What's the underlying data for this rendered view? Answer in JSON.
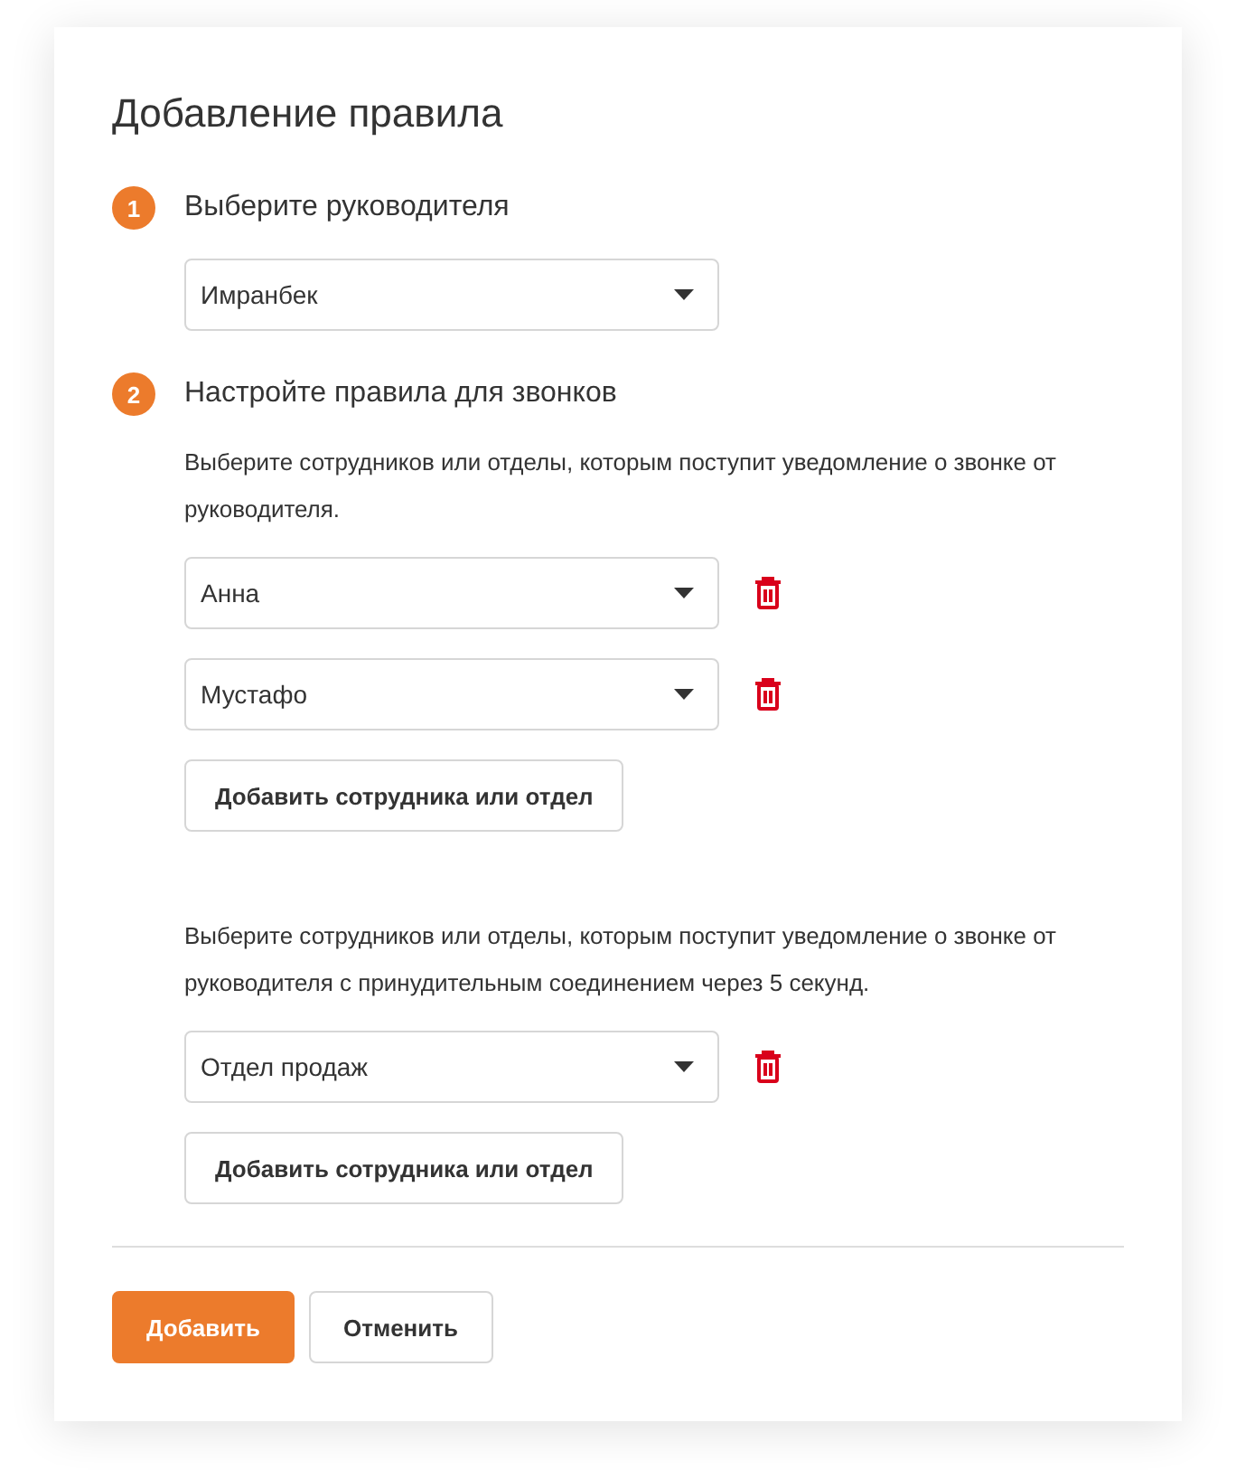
{
  "title": "Добавление правила",
  "steps": [
    {
      "number": "1",
      "label": "Выберите руководителя",
      "selects": [
        {
          "value": "Имранбек",
          "deletable": false
        }
      ]
    },
    {
      "number": "2",
      "label": "Настройте правила для звонков",
      "groups": [
        {
          "description": "Выберите сотрудников или отделы, которым поступит уведомление о звонке от руководителя.",
          "selects": [
            {
              "value": "Анна",
              "deletable": true
            },
            {
              "value": "Мустафо",
              "deletable": true
            }
          ],
          "add_button": "Добавить сотрудника или отдел"
        },
        {
          "description": "Выберите сотрудников или отделы, которым поступит уведомление о звонке от руководителя с принудительным соединением через 5 секунд.",
          "selects": [
            {
              "value": "Отдел продаж",
              "deletable": true
            }
          ],
          "add_button": "Добавить сотрудника или отдел"
        }
      ]
    }
  ],
  "actions": [
    {
      "label": "Добавить",
      "kind": "primary"
    },
    {
      "label": "Отменить",
      "kind": "secondary"
    }
  ]
}
